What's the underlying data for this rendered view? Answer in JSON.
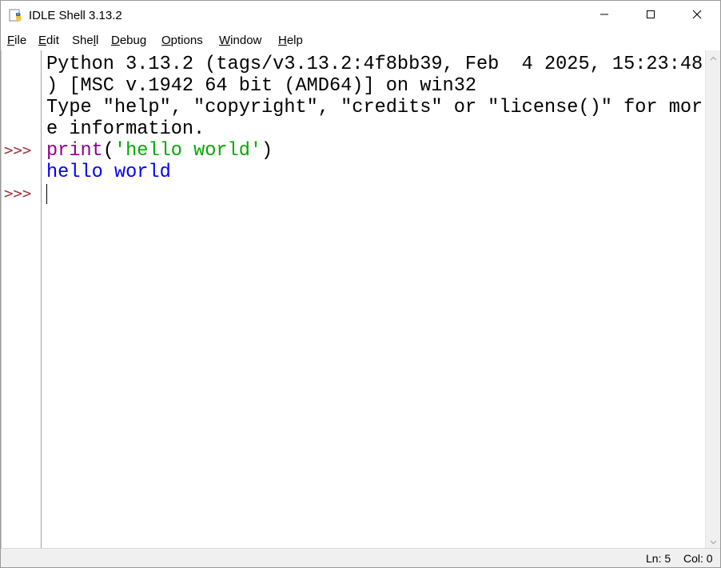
{
  "window": {
    "title": "IDLE Shell 3.13.2",
    "icon": "python-idle-icon",
    "controls": {
      "minimize": "minimize-icon",
      "maximize": "maximize-icon",
      "close": "close-icon"
    }
  },
  "menubar": {
    "items": [
      {
        "mnemonic": "F",
        "rest": "ile"
      },
      {
        "mnemonic": "E",
        "rest": "dit"
      },
      {
        "pre": "She",
        "mnemonic": "l",
        "rest": "l"
      },
      {
        "mnemonic": "D",
        "rest": "ebug"
      },
      {
        "mnemonic": "O",
        "rest": "ptions"
      },
      {
        "mnemonic": "W",
        "rest": "indow"
      },
      {
        "mnemonic": "H",
        "rest": "elp"
      }
    ]
  },
  "shell": {
    "banner_line1": "Python 3.13.2 (tags/v3.13.2:4f8bb39, Feb  4 2025, 15:23:48",
    "banner_line2": ") [MSC v.1942 64 bit (AMD64)] on win32",
    "banner_line3": "Type \"help\", \"copyright\", \"credits\" or \"license()\" for mor",
    "banner_line4": "e information.",
    "prompt": ">>>",
    "input1_func": "print",
    "input1_open": "(",
    "input1_string": "'hello world'",
    "input1_close": ")",
    "output1": "hello world"
  },
  "statusbar": {
    "line": "Ln: 5",
    "col": "Col: 0"
  },
  "colors": {
    "prompt": "#a3333a",
    "builtin": "#900090",
    "string": "#00aa00",
    "stdout": "#0000ff",
    "text": "#000000"
  }
}
